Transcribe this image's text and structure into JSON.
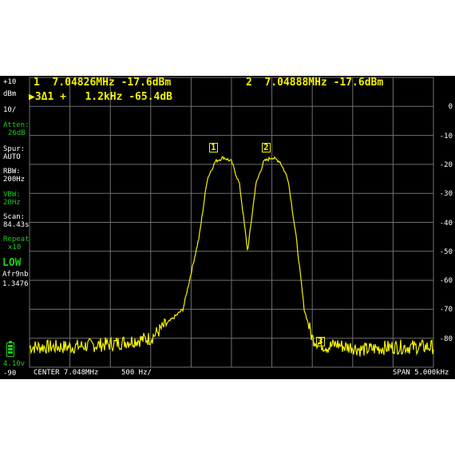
{
  "sidebar": {
    "ref_level": "+10",
    "unit": "dBm",
    "scale": "10/",
    "atten_label": "Atten:",
    "atten_value": "26dB",
    "spur_label": "Spur:",
    "spur_value": "AUTO",
    "rbw_label": "RBW:",
    "rbw_value": "200Hz",
    "vbw_label": "VBW:",
    "vbw_value": "20Hz",
    "scan_label": "Scan:",
    "scan_value": "84.43s",
    "repeat_label": "Repeat",
    "repeat_value": "x10",
    "mode": "LOW",
    "callsign": "Afr9nb",
    "version": "1.3476",
    "voltage": "4.10v",
    "bottom_level": "-90"
  },
  "markers": {
    "m1": "1  7.04826MHz -17.6dBm",
    "m2": "2  7.04888MHz -17.6dBm",
    "m3": "▶3Δ1 +   1.2kHz -65.4dB",
    "label1": "1",
    "label2": "2",
    "label3": "3"
  },
  "footer": {
    "center": "CENTER 7.048MHz",
    "div": "500 Hz/",
    "span": "SPAN 5.000kHz"
  },
  "colors": {
    "trace": "#f2f200",
    "grid": "#707070",
    "green": "#21c821",
    "background": "#000000"
  },
  "chart_data": {
    "type": "line",
    "x_unit": "kHz offset from center",
    "xlim": [
      -2.5,
      2.5
    ],
    "ylim": [
      -90,
      10
    ],
    "y_ticks": [
      "0",
      "-10",
      "-20",
      "-30",
      "-40",
      "-50",
      "-60",
      "-70",
      "-80"
    ],
    "y_tick_values": [
      0,
      -10,
      -20,
      -30,
      -40,
      -50,
      -60,
      -70,
      -80
    ],
    "series": [
      {
        "x": [
          -2.5,
          -2.0,
          -1.5,
          -1.0,
          -0.6,
          -0.4,
          -0.3,
          -0.2,
          -0.1,
          0.0,
          0.1,
          0.2,
          0.3,
          0.4,
          0.5,
          0.6,
          0.7,
          0.8,
          0.9,
          1.0,
          1.1,
          1.2,
          1.3,
          1.4,
          1.5,
          1.6,
          2.0,
          2.5
        ],
        "y": [
          -83,
          -83,
          -82,
          -80,
          -70,
          -45,
          -25,
          -19,
          -17.6,
          -19,
          -27,
          -50,
          -27,
          -19,
          -17.6,
          -19,
          -25,
          -45,
          -70,
          -80,
          -82,
          -83,
          -82,
          -83,
          -83,
          -84,
          -83,
          -83
        ]
      }
    ]
  }
}
